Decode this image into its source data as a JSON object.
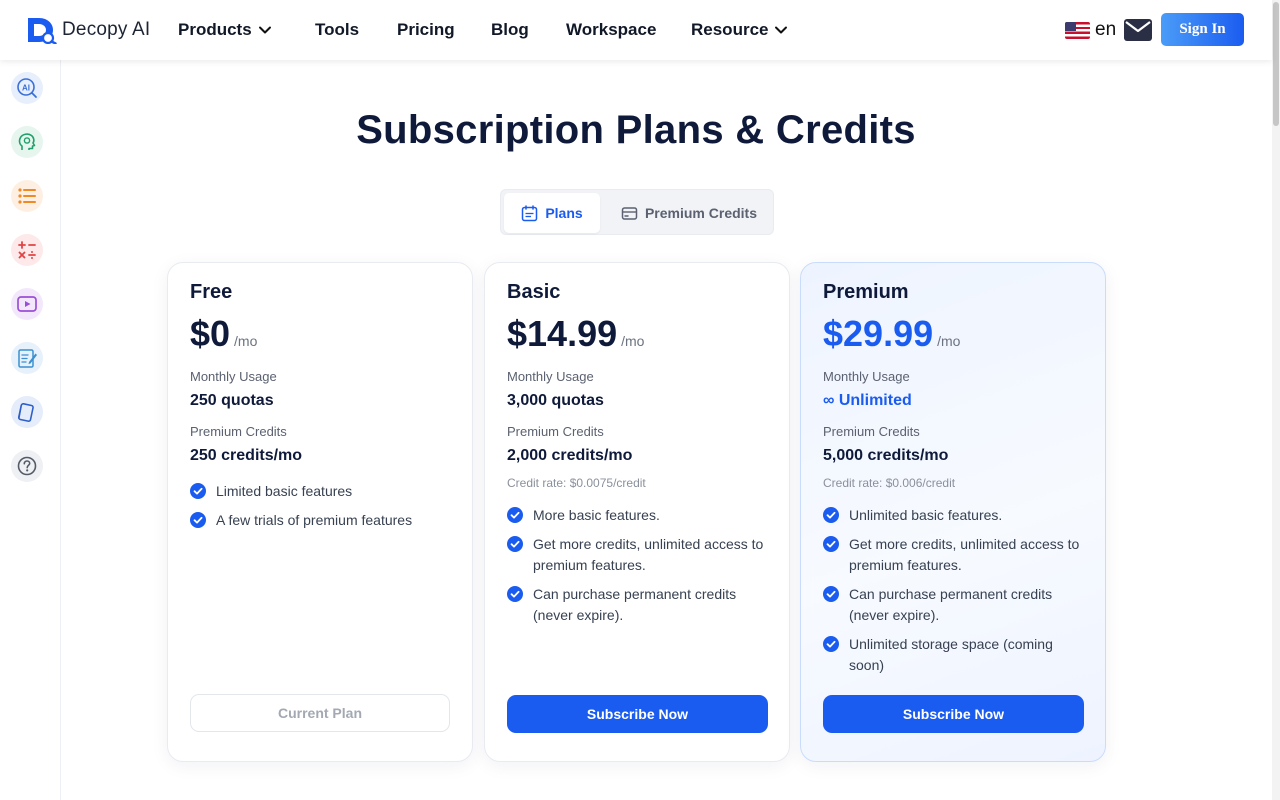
{
  "header": {
    "brand": "Decopy AI",
    "nav": [
      {
        "label": "Products",
        "dropdown": true
      },
      {
        "label": "Tools",
        "dropdown": false
      },
      {
        "label": "Pricing",
        "dropdown": false
      },
      {
        "label": "Blog",
        "dropdown": false
      },
      {
        "label": "Workspace",
        "dropdown": false
      },
      {
        "label": "Resource",
        "dropdown": true
      }
    ],
    "language": "en",
    "sign_in": "Sign In"
  },
  "sidebar": {
    "items": [
      {
        "icon": "ai-detector-icon",
        "color": "#3b6fd8"
      },
      {
        "icon": "ai-humanizer-icon",
        "color": "#22a06b"
      },
      {
        "icon": "list-icon",
        "color": "#f08a24"
      },
      {
        "icon": "math-solver-icon",
        "color": "#e04444"
      },
      {
        "icon": "video-icon",
        "color": "#9b4fd6"
      },
      {
        "icon": "essay-writer-icon",
        "color": "#3a8fd0"
      },
      {
        "icon": "flashcards-icon",
        "color": "#2e5fc8"
      },
      {
        "icon": "help-icon",
        "color": "#555b66"
      }
    ]
  },
  "page": {
    "title": "Subscription Plans & Credits",
    "tabs": [
      {
        "label": "Plans",
        "active": true
      },
      {
        "label": "Premium Credits",
        "active": false
      }
    ]
  },
  "plans": [
    {
      "name": "Free",
      "price": "$0",
      "unit": "/mo",
      "usage_label": "Monthly Usage",
      "usage_value": "250 quotas",
      "credits_label": "Premium Credits",
      "credits_value": "250 credits/mo",
      "features": [
        "Limited basic features",
        "A few trials of premium features"
      ],
      "button": "Current Plan"
    },
    {
      "name": "Basic",
      "price": "$14.99",
      "unit": "/mo",
      "usage_label": "Monthly Usage",
      "usage_value": "3,000 quotas",
      "credits_label": "Premium Credits",
      "credits_value": "2,000 credits/mo",
      "rate": "Credit rate: $0.0075/credit",
      "features": [
        "More basic features.",
        "Get more credits, unlimited access to premium features.",
        "Can purchase permanent credits (never expire)."
      ],
      "button": "Subscribe Now"
    },
    {
      "name": "Premium",
      "price": "$29.99",
      "unit": "/mo",
      "usage_label": "Monthly Usage",
      "usage_value": "∞ Unlimited",
      "credits_label": "Premium Credits",
      "credits_value": "5,000 credits/mo",
      "rate": "Credit rate: $0.006/credit",
      "features": [
        "Unlimited basic features.",
        "Get more credits, unlimited access to premium features.",
        "Can purchase permanent credits (never expire).",
        "Unlimited storage space (coming soon)"
      ],
      "button": "Subscribe Now"
    }
  ],
  "colors": {
    "accent": "#1b5cf0",
    "title": "#0f1a3a",
    "check": "#1b5cf0"
  }
}
